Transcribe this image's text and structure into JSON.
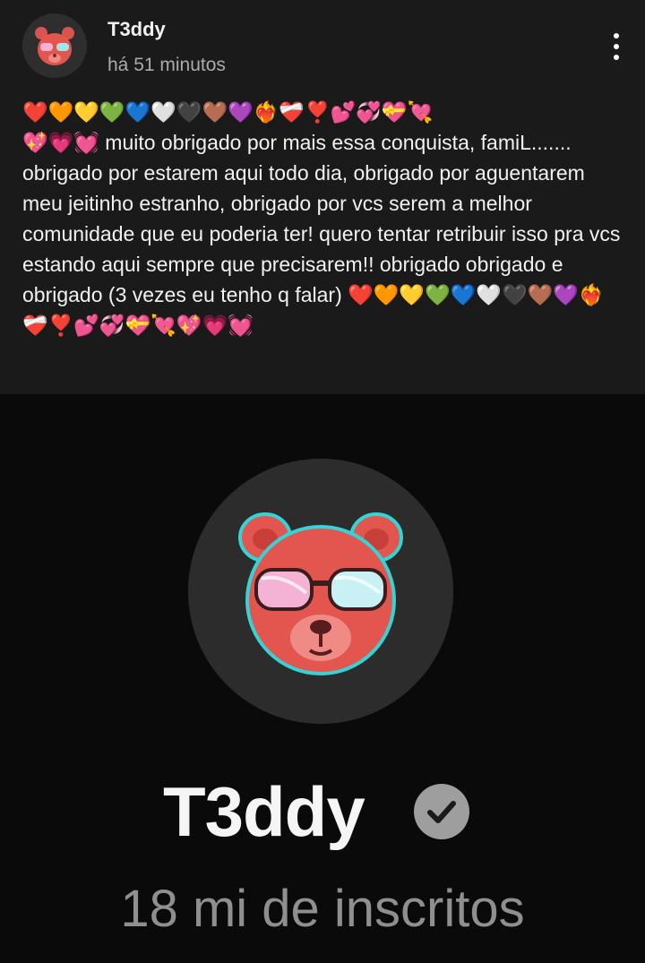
{
  "post": {
    "channel_name": "T3ddy",
    "time": "há 51 minutos",
    "avatar_icon": "bear-with-sunglasses-icon",
    "menu_icon": "more-vertical-icon",
    "text": "❤️🧡💛💚💙🤍🖤🤎💜❤️‍🔥❤️‍🩹❣️💕💞💝💘\n💖💗💓 muito obrigado por mais essa conquista, famiL....... obrigado por estarem aqui todo dia, obrigado por aguentarem meu jeitinho estranho, obrigado por vcs serem a melhor comunidade que eu poderia ter! quero tentar retribuir isso pra vcs estando aqui sempre que precisarem!! obrigado obrigado e obrigado (3 vezes eu tenho q falar) ❤️🧡💛💚💙🤍🖤🤎💜❤️‍🔥❤️‍🩹❣️💕💞💝💘💖💗💓"
  },
  "image": {
    "channel_name": "T3ddy",
    "verified_icon": "verified-check-icon",
    "subscribers": "18 mi de inscritos",
    "colors": {
      "background": "#0a0a0a",
      "avatar_circle": "#2c2c2c",
      "bear": "#e2564f",
      "glasses": "#f4b2d4"
    }
  }
}
